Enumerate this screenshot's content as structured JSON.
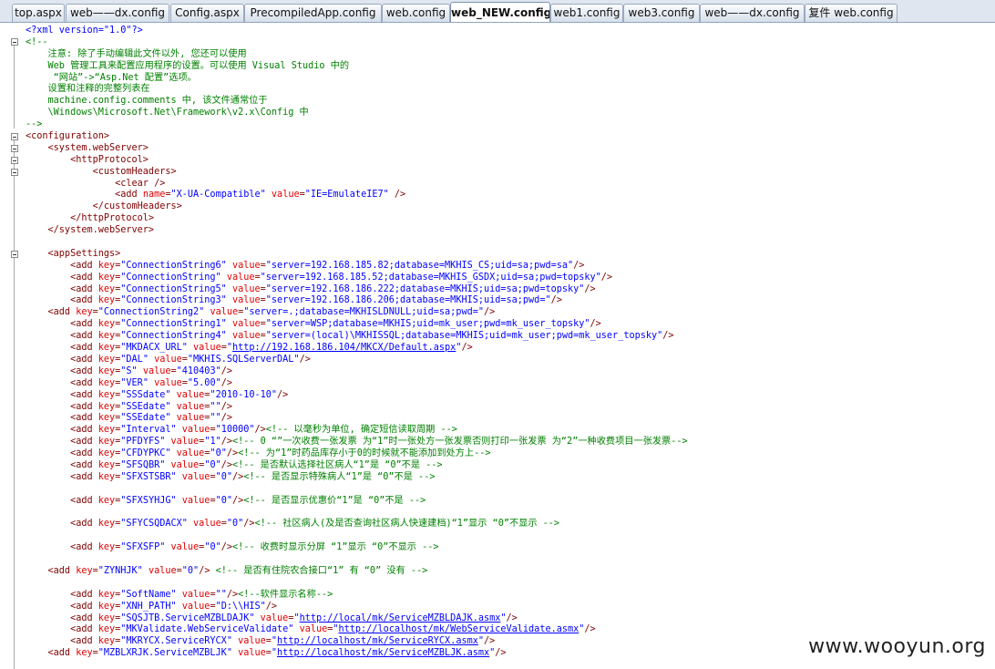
{
  "tabs": [
    {
      "label": "top.aspx"
    },
    {
      "label": "web——dx.config"
    },
    {
      "label": "Config.aspx"
    },
    {
      "label": "PrecompiledApp.config"
    },
    {
      "label": "web.config"
    },
    {
      "label": "web_NEW.config",
      "active": true
    },
    {
      "label": "web1.config"
    },
    {
      "label": "web3.config"
    },
    {
      "label": "web——dx.config"
    },
    {
      "label": "复件 web.config"
    }
  ],
  "lines": [
    [
      [
        "pi",
        "<?xml version=\"1.0\"?>"
      ]
    ],
    [
      [
        "cm",
        "<!--"
      ]
    ],
    [
      [
        "cm",
        "    注意: 除了手动编辑此文件以外, 您还可以使用"
      ]
    ],
    [
      [
        "cm",
        "    Web 管理工具来配置应用程序的设置。可以使用 Visual Studio 中的"
      ]
    ],
    [
      [
        "cm",
        "     “网站”->“Asp.Net 配置”选项。"
      ]
    ],
    [
      [
        "cm",
        "    设置和注释的完整列表在"
      ]
    ],
    [
      [
        "cm",
        "    machine.config.comments 中, 该文件通常位于"
      ]
    ],
    [
      [
        "cm",
        "    \\Windows\\Microsoft.Net\\Framework\\v2.x\\Config 中"
      ]
    ],
    [
      [
        "cm",
        "-->"
      ]
    ],
    [
      [
        "el",
        "<configuration>"
      ]
    ],
    [
      [
        "el",
        "    <system.webServer>"
      ]
    ],
    [
      [
        "el",
        "        <httpProtocol>"
      ]
    ],
    [
      [
        "el",
        "            <customHeaders>"
      ]
    ],
    [
      [
        "el",
        "                <clear />"
      ]
    ],
    [
      [
        "el",
        "                <add "
      ],
      [
        "at",
        "name"
      ],
      [
        "el",
        "="
      ],
      [
        "va",
        "\"X-UA-Compatible\""
      ],
      [
        "el",
        " "
      ],
      [
        "at",
        "value"
      ],
      [
        "el",
        "="
      ],
      [
        "va",
        "\"IE=EmulateIE7\""
      ],
      [
        "el",
        " />"
      ]
    ],
    [
      [
        "el",
        "            </customHeaders>"
      ]
    ],
    [
      [
        "el",
        "        </httpProtocol>"
      ]
    ],
    [
      [
        "el",
        "    </system.webServer>"
      ]
    ],
    [
      [
        "el",
        ""
      ]
    ],
    [
      [
        "el",
        "    <appSettings>"
      ]
    ],
    [
      [
        "el",
        "        <add "
      ],
      [
        "at",
        "key"
      ],
      [
        "el",
        "="
      ],
      [
        "va",
        "\"ConnectionString6\""
      ],
      [
        "el",
        " "
      ],
      [
        "at",
        "value"
      ],
      [
        "el",
        "="
      ],
      [
        "va",
        "\"server=192.168.185.82;database=MKHIS_CS;uid=sa;pwd=sa\""
      ],
      [
        "el",
        "/>"
      ]
    ],
    [
      [
        "el",
        "        <add "
      ],
      [
        "at",
        "key"
      ],
      [
        "el",
        "="
      ],
      [
        "va",
        "\"ConnectionString\""
      ],
      [
        "el",
        " "
      ],
      [
        "at",
        "value"
      ],
      [
        "el",
        "="
      ],
      [
        "va",
        "\"server=192.168.185.52;database=MKHIS_GSDX;uid=sa;pwd=topsky\""
      ],
      [
        "el",
        "/>"
      ]
    ],
    [
      [
        "el",
        "        <add "
      ],
      [
        "at",
        "key"
      ],
      [
        "el",
        "="
      ],
      [
        "va",
        "\"ConnectionString5\""
      ],
      [
        "el",
        " "
      ],
      [
        "at",
        "value"
      ],
      [
        "el",
        "="
      ],
      [
        "va",
        "\"server=192.168.186.222;database=MKHIS;uid=sa;pwd=topsky\""
      ],
      [
        "el",
        "/>"
      ]
    ],
    [
      [
        "el",
        "        <add "
      ],
      [
        "at",
        "key"
      ],
      [
        "el",
        "="
      ],
      [
        "va",
        "\"ConnectionString3\""
      ],
      [
        "el",
        " "
      ],
      [
        "at",
        "value"
      ],
      [
        "el",
        "="
      ],
      [
        "va",
        "\"server=192.168.186.206;database=MKHIS;uid=sa;pwd=\""
      ],
      [
        "el",
        "/>"
      ]
    ],
    [
      [
        "el",
        "    <add "
      ],
      [
        "at",
        "key"
      ],
      [
        "el",
        "="
      ],
      [
        "va",
        "\"ConnectionString2\""
      ],
      [
        "el",
        " "
      ],
      [
        "at",
        "value"
      ],
      [
        "el",
        "="
      ],
      [
        "va",
        "\"server=.;database=MKHISLDNULL;uid=sa;pwd=\""
      ],
      [
        "el",
        "/>"
      ]
    ],
    [
      [
        "el",
        "        <add "
      ],
      [
        "at",
        "key"
      ],
      [
        "el",
        "="
      ],
      [
        "va",
        "\"ConnectionString1\""
      ],
      [
        "el",
        " "
      ],
      [
        "at",
        "value"
      ],
      [
        "el",
        "="
      ],
      [
        "va",
        "\"server=WSP;database=MKHIS;uid=mk_user;pwd=mk_user_topsky\""
      ],
      [
        "el",
        "/>"
      ]
    ],
    [
      [
        "el",
        "        <add "
      ],
      [
        "at",
        "key"
      ],
      [
        "el",
        "="
      ],
      [
        "va",
        "\"ConnectionString4\""
      ],
      [
        "el",
        " "
      ],
      [
        "at",
        "value"
      ],
      [
        "el",
        "="
      ],
      [
        "va",
        "\"server=(local)\\MKHISSQL;database=MKHIS;uid=mk_user;pwd=mk_user_topsky\""
      ],
      [
        "el",
        "/>"
      ]
    ],
    [
      [
        "el",
        "        <add "
      ],
      [
        "at",
        "key"
      ],
      [
        "el",
        "="
      ],
      [
        "va",
        "\"MKDACX_URL\""
      ],
      [
        "el",
        " "
      ],
      [
        "at",
        "value"
      ],
      [
        "el",
        "="
      ],
      [
        "va",
        "\""
      ],
      [
        "lk",
        "http://192.168.186.104/MKCX/Default.aspx"
      ],
      [
        "va",
        "\""
      ],
      [
        "el",
        "/>"
      ]
    ],
    [
      [
        "el",
        "        <add "
      ],
      [
        "at",
        "key"
      ],
      [
        "el",
        "="
      ],
      [
        "va",
        "\"DAL\""
      ],
      [
        "el",
        " "
      ],
      [
        "at",
        "value"
      ],
      [
        "el",
        "="
      ],
      [
        "va",
        "\"MKHIS.SQLServerDAL\""
      ],
      [
        "el",
        "/>"
      ]
    ],
    [
      [
        "el",
        "        <add "
      ],
      [
        "at",
        "key"
      ],
      [
        "el",
        "="
      ],
      [
        "va",
        "\"S\""
      ],
      [
        "el",
        " "
      ],
      [
        "at",
        "value"
      ],
      [
        "el",
        "="
      ],
      [
        "va",
        "\"410403\""
      ],
      [
        "el",
        "/>"
      ]
    ],
    [
      [
        "el",
        "        <add "
      ],
      [
        "at",
        "key"
      ],
      [
        "el",
        "="
      ],
      [
        "va",
        "\"VER\""
      ],
      [
        "el",
        " "
      ],
      [
        "at",
        "value"
      ],
      [
        "el",
        "="
      ],
      [
        "va",
        "\"5.00\""
      ],
      [
        "el",
        "/>"
      ]
    ],
    [
      [
        "el",
        "        <add "
      ],
      [
        "at",
        "key"
      ],
      [
        "el",
        "="
      ],
      [
        "va",
        "\"SSSdate\""
      ],
      [
        "el",
        " "
      ],
      [
        "at",
        "value"
      ],
      [
        "el",
        "="
      ],
      [
        "va",
        "\"2010-10-10\""
      ],
      [
        "el",
        "/>"
      ]
    ],
    [
      [
        "el",
        "        <add "
      ],
      [
        "at",
        "key"
      ],
      [
        "el",
        "="
      ],
      [
        "va",
        "\"SSEdate\""
      ],
      [
        "el",
        " "
      ],
      [
        "at",
        "value"
      ],
      [
        "el",
        "="
      ],
      [
        "va",
        "\"\""
      ],
      [
        "el",
        "/>"
      ]
    ],
    [
      [
        "el",
        "        <add "
      ],
      [
        "at",
        "key"
      ],
      [
        "el",
        "="
      ],
      [
        "va",
        "\"SSEdate\""
      ],
      [
        "el",
        " "
      ],
      [
        "at",
        "value"
      ],
      [
        "el",
        "="
      ],
      [
        "va",
        "\"\""
      ],
      [
        "el",
        "/>"
      ]
    ],
    [
      [
        "el",
        "        <add "
      ],
      [
        "at",
        "key"
      ],
      [
        "el",
        "="
      ],
      [
        "va",
        "\"Interval\""
      ],
      [
        "el",
        " "
      ],
      [
        "at",
        "value"
      ],
      [
        "el",
        "="
      ],
      [
        "va",
        "\"10000\""
      ],
      [
        "el",
        "/>"
      ],
      [
        "cm",
        "<!-- 以毫秒为单位, 确定短信读取周期 -->"
      ]
    ],
    [
      [
        "el",
        "        <add "
      ],
      [
        "at",
        "key"
      ],
      [
        "el",
        "="
      ],
      [
        "va",
        "\"PFDYFS\""
      ],
      [
        "el",
        " "
      ],
      [
        "at",
        "value"
      ],
      [
        "el",
        "="
      ],
      [
        "va",
        "\"1\""
      ],
      [
        "el",
        "/>"
      ],
      [
        "cm",
        "<!-- 0 “”一次收费一张发票 为“1”时一张处方一张发票否则打印一张发票 为“2”一种收费项目一张发票-->"
      ]
    ],
    [
      [
        "el",
        "        <add "
      ],
      [
        "at",
        "key"
      ],
      [
        "el",
        "="
      ],
      [
        "va",
        "\"CFDYPKC\""
      ],
      [
        "el",
        " "
      ],
      [
        "at",
        "value"
      ],
      [
        "el",
        "="
      ],
      [
        "va",
        "\"0\""
      ],
      [
        "el",
        "/>"
      ],
      [
        "cm",
        "<!-- 为“1”时药品库存小于0的时候就不能添加到处方上-->"
      ]
    ],
    [
      [
        "el",
        "        <add "
      ],
      [
        "at",
        "key"
      ],
      [
        "el",
        "="
      ],
      [
        "va",
        "\"SFSQBR\""
      ],
      [
        "el",
        " "
      ],
      [
        "at",
        "value"
      ],
      [
        "el",
        "="
      ],
      [
        "va",
        "\"0\""
      ],
      [
        "el",
        "/>"
      ],
      [
        "cm",
        "<!-- 是否默认选择社区病人“1”是 “0”不是 -->"
      ]
    ],
    [
      [
        "el",
        "        <add "
      ],
      [
        "at",
        "key"
      ],
      [
        "el",
        "="
      ],
      [
        "va",
        "\"SFXSTSBR\""
      ],
      [
        "el",
        " "
      ],
      [
        "at",
        "value"
      ],
      [
        "el",
        "="
      ],
      [
        "va",
        "\"0\""
      ],
      [
        "el",
        "/>"
      ],
      [
        "cm",
        "<!-- 是否显示特殊病人“1”是 “0”不是 -->"
      ]
    ],
    [
      [
        "el",
        ""
      ]
    ],
    [
      [
        "el",
        "        <add "
      ],
      [
        "at",
        "key"
      ],
      [
        "el",
        "="
      ],
      [
        "va",
        "\"SFXSYHJG\""
      ],
      [
        "el",
        " "
      ],
      [
        "at",
        "value"
      ],
      [
        "el",
        "="
      ],
      [
        "va",
        "\"0\""
      ],
      [
        "el",
        "/>"
      ],
      [
        "cm",
        "<!-- 是否显示优惠价“1”是 “0”不是 -->"
      ]
    ],
    [
      [
        "el",
        ""
      ]
    ],
    [
      [
        "el",
        "        <add "
      ],
      [
        "at",
        "key"
      ],
      [
        "el",
        "="
      ],
      [
        "va",
        "\"SFYCSQDACX\""
      ],
      [
        "el",
        " "
      ],
      [
        "at",
        "value"
      ],
      [
        "el",
        "="
      ],
      [
        "va",
        "\"0\""
      ],
      [
        "el",
        "/>"
      ],
      [
        "cm",
        "<!-- 社区病人(及是否查询社区病人快速建档)“1”显示 “0”不显示 -->"
      ]
    ],
    [
      [
        "el",
        ""
      ]
    ],
    [
      [
        "el",
        "        <add "
      ],
      [
        "at",
        "key"
      ],
      [
        "el",
        "="
      ],
      [
        "va",
        "\"SFXSFP\""
      ],
      [
        "el",
        " "
      ],
      [
        "at",
        "value"
      ],
      [
        "el",
        "="
      ],
      [
        "va",
        "\"0\""
      ],
      [
        "el",
        "/>"
      ],
      [
        "cm",
        "<!-- 收费时显示分屏 “1”显示 “0”不显示 -->"
      ]
    ],
    [
      [
        "el",
        ""
      ]
    ],
    [
      [
        "el",
        "    <add "
      ],
      [
        "at",
        "key"
      ],
      [
        "el",
        "="
      ],
      [
        "va",
        "\"ZYNHJK\""
      ],
      [
        "el",
        " "
      ],
      [
        "at",
        "value"
      ],
      [
        "el",
        "="
      ],
      [
        "va",
        "\"0\""
      ],
      [
        "el",
        "/> "
      ],
      [
        "cm",
        "<!-- 是否有住院农合接口“1” 有 “0” 没有 -->"
      ]
    ],
    [
      [
        "el",
        ""
      ]
    ],
    [
      [
        "el",
        "        <add "
      ],
      [
        "at",
        "key"
      ],
      [
        "el",
        "="
      ],
      [
        "va",
        "\"SoftName\""
      ],
      [
        "el",
        " "
      ],
      [
        "at",
        "value"
      ],
      [
        "el",
        "="
      ],
      [
        "va",
        "\"\""
      ],
      [
        "el",
        "/>"
      ],
      [
        "cm",
        "<!--软件显示名称-->"
      ]
    ],
    [
      [
        "el",
        "        <add "
      ],
      [
        "at",
        "key"
      ],
      [
        "el",
        "="
      ],
      [
        "va",
        "\"XNH_PATH\""
      ],
      [
        "el",
        " "
      ],
      [
        "at",
        "value"
      ],
      [
        "el",
        "="
      ],
      [
        "va",
        "\"D:\\\\HIS\""
      ],
      [
        "el",
        "/>"
      ]
    ],
    [
      [
        "el",
        "        <add "
      ],
      [
        "at",
        "key"
      ],
      [
        "el",
        "="
      ],
      [
        "va",
        "\"SQSJTB.ServiceMZBLDAJK\""
      ],
      [
        "el",
        " "
      ],
      [
        "at",
        "value"
      ],
      [
        "el",
        "="
      ],
      [
        "va",
        "\""
      ],
      [
        "lk",
        "http://local/mk/ServiceMZBLDAJK.asmx"
      ],
      [
        "va",
        "\""
      ],
      [
        "el",
        "/>"
      ]
    ],
    [
      [
        "el",
        "        <add "
      ],
      [
        "at",
        "key"
      ],
      [
        "el",
        "="
      ],
      [
        "va",
        "\"MKValidate.WebServiceValidate\""
      ],
      [
        "el",
        " "
      ],
      [
        "at",
        "value"
      ],
      [
        "el",
        "="
      ],
      [
        "va",
        "\""
      ],
      [
        "lk",
        "http://localhost/mk/WebServiceValidate.asmx"
      ],
      [
        "va",
        "\""
      ],
      [
        "el",
        "/>"
      ]
    ],
    [
      [
        "el",
        "        <add "
      ],
      [
        "at",
        "key"
      ],
      [
        "el",
        "="
      ],
      [
        "va",
        "\"MKRYCX.ServiceRYCX\""
      ],
      [
        "el",
        " "
      ],
      [
        "at",
        "value"
      ],
      [
        "el",
        "="
      ],
      [
        "va",
        "\""
      ],
      [
        "lk",
        "http://localhost/mk/ServiceRYCX.asmx"
      ],
      [
        "va",
        "\""
      ],
      [
        "el",
        "/>"
      ]
    ],
    [
      [
        "el",
        "    <add "
      ],
      [
        "at",
        "key"
      ],
      [
        "el",
        "="
      ],
      [
        "va",
        "\"MZBLXRJK.ServiceMZBLJK\""
      ],
      [
        "el",
        " "
      ],
      [
        "at",
        "value"
      ],
      [
        "el",
        "="
      ],
      [
        "va",
        "\""
      ],
      [
        "lk",
        "http://localhost/mk/ServiceMZBLJK.asmx"
      ],
      [
        "va",
        "\""
      ],
      [
        "el",
        "/>"
      ]
    ]
  ],
  "watermark": "www.wooyun.org"
}
